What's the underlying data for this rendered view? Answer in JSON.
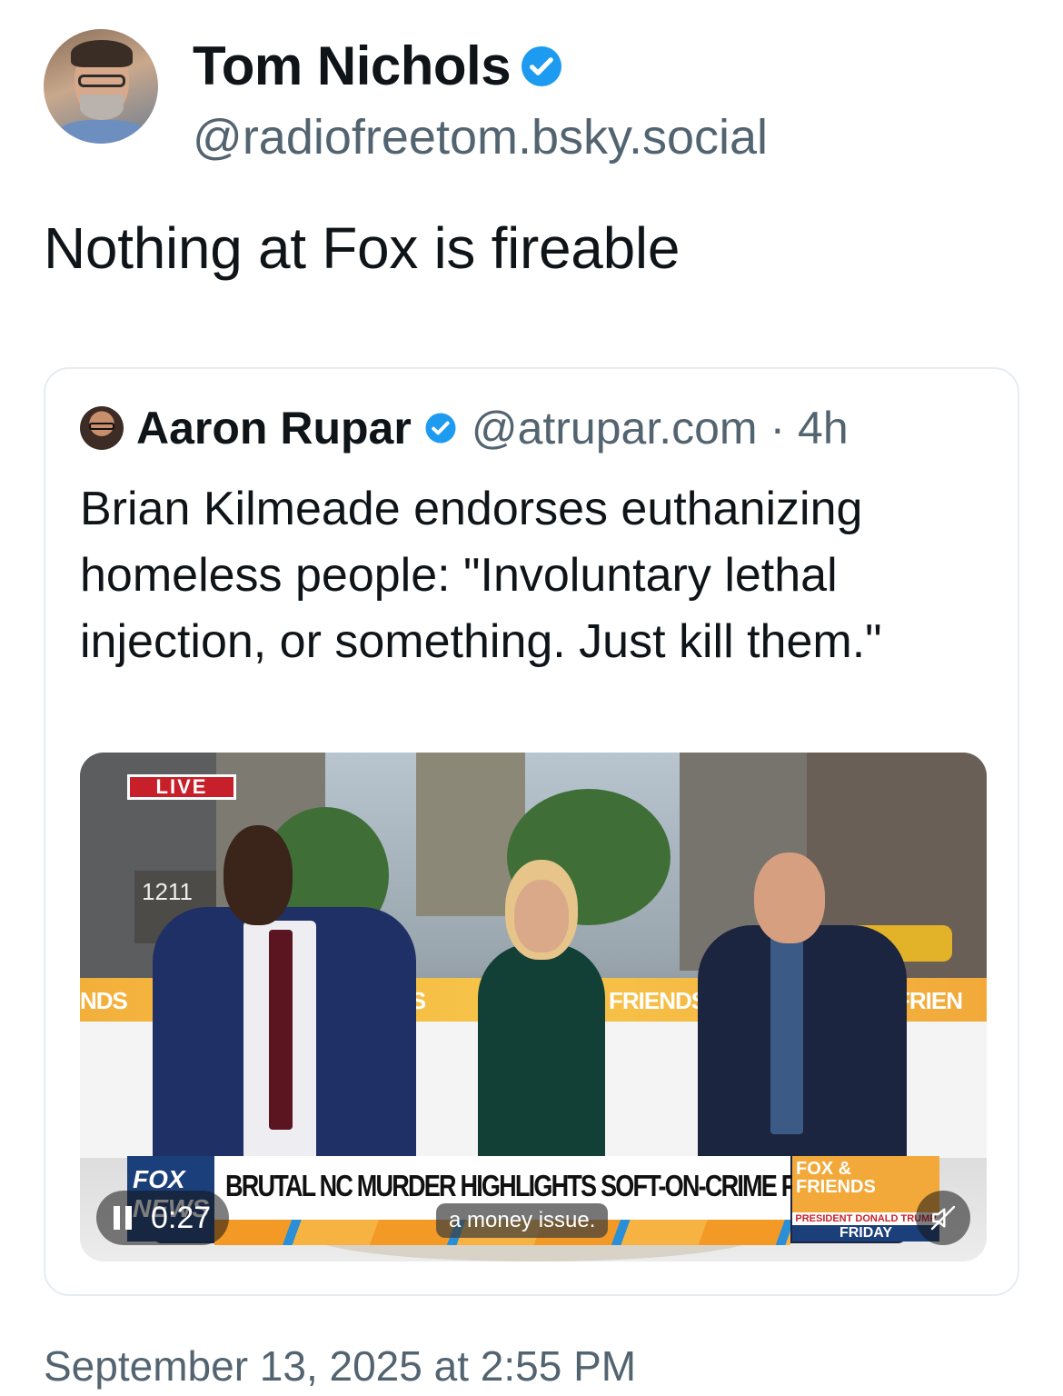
{
  "post": {
    "author": {
      "display_name": "Tom Nichols",
      "handle": "@radiofreetom.bsky.social",
      "verified": true
    },
    "text": "Nothing at Fox is fireable",
    "timestamp": "September 13, 2025 at 2:55 PM"
  },
  "quoted_post": {
    "author": {
      "display_name": "Aaron Rupar",
      "handle": "@atrupar.com · 4h",
      "verified": true
    },
    "text": "Brian Kilmeade endorses euthanizing homeless people: \"Involuntary lethal injection, or something. Just kill them.\"",
    "video": {
      "live_badge": "LIVE",
      "band_left": "NDS",
      "band_mid1": "DS",
      "band_mid2": "FRIENDS",
      "band_right": "FRIEN",
      "network_logo": "FOX NEWS",
      "headline": "BRUTAL NC MURDER HIGHLIGHTS SOFT-ON-CRIME POLICIES",
      "show_logo_line1": "FOX &",
      "show_logo_line2": "FRIENDS",
      "show_sub": "PRESIDENT DONALD TRUMP",
      "show_day": "FRIDAY",
      "elapsed": "0:27",
      "caption": "a money issue.",
      "building_number": "1211"
    }
  },
  "colors": {
    "verified_blue": "#1d9bf0",
    "secondary_text": "#536471",
    "fox_blue": "#1b3f7a",
    "fox_orange": "#f2a93a",
    "live_red": "#c8202a"
  },
  "icons": [
    "verified-badge-icon",
    "pause-icon",
    "muted-speaker-icon"
  ]
}
